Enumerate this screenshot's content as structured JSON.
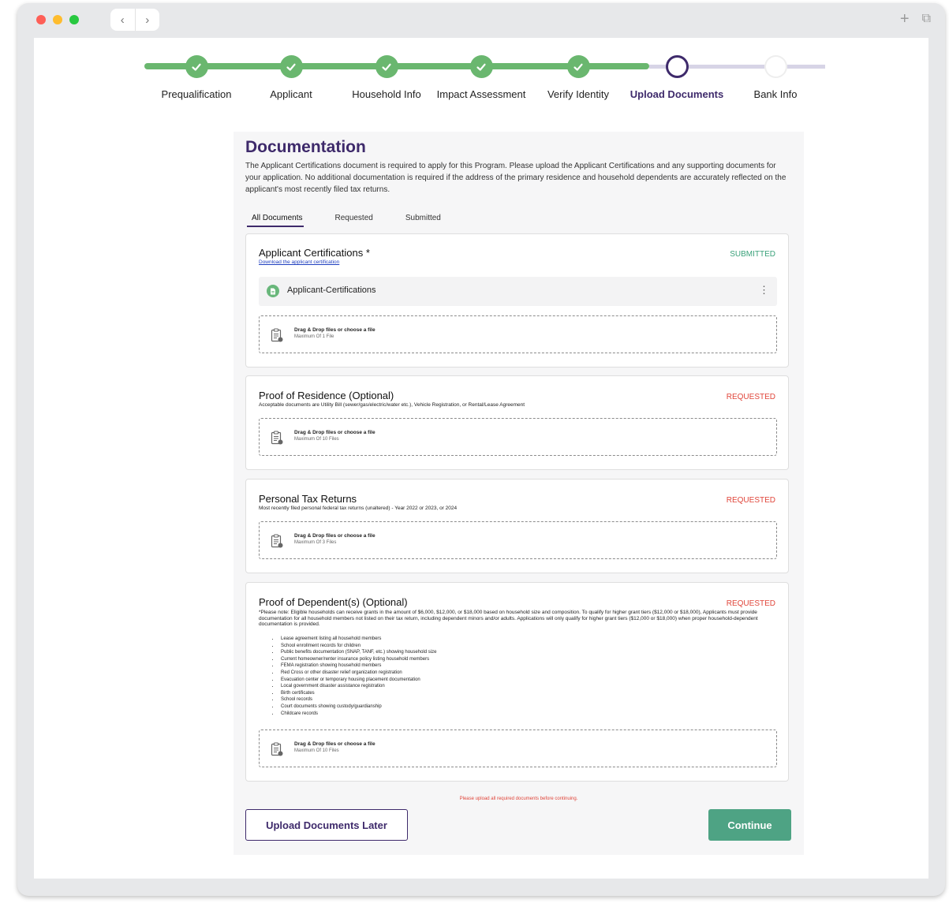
{
  "browser": {
    "back_icon": "‹",
    "forward_icon": "›",
    "new_tab_icon": "+",
    "tabs_icon": "⧉"
  },
  "stepper": {
    "steps": [
      {
        "label": "Prequalification",
        "state": "done"
      },
      {
        "label": "Applicant",
        "state": "done"
      },
      {
        "label": "Household Info",
        "state": "done"
      },
      {
        "label": "Impact Assessment",
        "state": "done"
      },
      {
        "label": "Verify Identity",
        "state": "done"
      },
      {
        "label": "Upload Documents",
        "state": "active"
      },
      {
        "label": "Bank Info",
        "state": "todo"
      }
    ]
  },
  "page": {
    "title": "Documentation",
    "intro": "The Applicant Certifications document is required to apply for this Program. Please upload the Applicant Certifications and any supporting documents for your application. No additional documentation is required if the address of the primary residence and household dependents are accurately reflected on the applicant's most recently filed tax returns."
  },
  "tabs": [
    {
      "label": "All Documents",
      "active": true
    },
    {
      "label": "Requested",
      "active": false
    },
    {
      "label": "Submitted",
      "active": false
    }
  ],
  "drop_label": "Drag & Drop files or choose a file",
  "cards": {
    "certifications": {
      "title": "Applicant Certifications *",
      "link": "Download the applicant certification",
      "status": "SUBMITTED",
      "file_name": "Applicant-Certifications",
      "drop_max": "Maximum Of 1 File"
    },
    "residence": {
      "title": "Proof of Residence (Optional)",
      "subtitle": "Acceptable documents are Utility Bill (sewer/gas/electric/water etc.), Vehicle Registration, or Rental/Lease Agreement",
      "status": "REQUESTED",
      "drop_max": "Maximum Of 10 Files"
    },
    "tax": {
      "title": "Personal Tax Returns",
      "subtitle": "Most recently filed personal federal tax returns (unaltered) - Year 2022 or 2023, or 2024",
      "status": "REQUESTED",
      "drop_max": "Maximum Of 3 Files"
    },
    "dependents": {
      "title": "Proof of Dependent(s) (Optional)",
      "note": "*Please note: Eligible households can receive grants in the amount of $6,000, $12,000, or $18,000 based on household size and composition. To qualify for higher grant tiers ($12,000 or $18,000), Applicants must provide documentation for all household members not listed on their tax return, including dependent minors and/or adults. Applications will only qualify for higher grant tiers ($12,000 or $18,000) when proper household-dependent documentation is provided.",
      "status": "REQUESTED",
      "list": [
        "Lease agreement listing all household members",
        "School enrollment records for children",
        "Public benefits documentation (SNAP, TANF, etc.) showing household size",
        "Current homeowner/renter insurance policy listing household members",
        "FEMA registration showing household members",
        "Red Cross or other disaster relief organization registration",
        "Evacuation center or temporary housing placement documentation",
        "Local government disaster assistance registration",
        "Birth certificates",
        "School records",
        "Court documents showing custody/guardianship",
        "Childcare records"
      ],
      "drop_max": "Maximum Of 10 Files"
    }
  },
  "footer": {
    "warning": "Please upload all required documents before continuing.",
    "later_label": "Upload Documents Later",
    "continue_label": "Continue"
  },
  "colors": {
    "brand_purple": "#3e2a6b",
    "progress_green": "#6ab76f",
    "submitted_green": "#3aa17a",
    "requested_red": "#e0453a",
    "continue_green": "#4ea384"
  }
}
